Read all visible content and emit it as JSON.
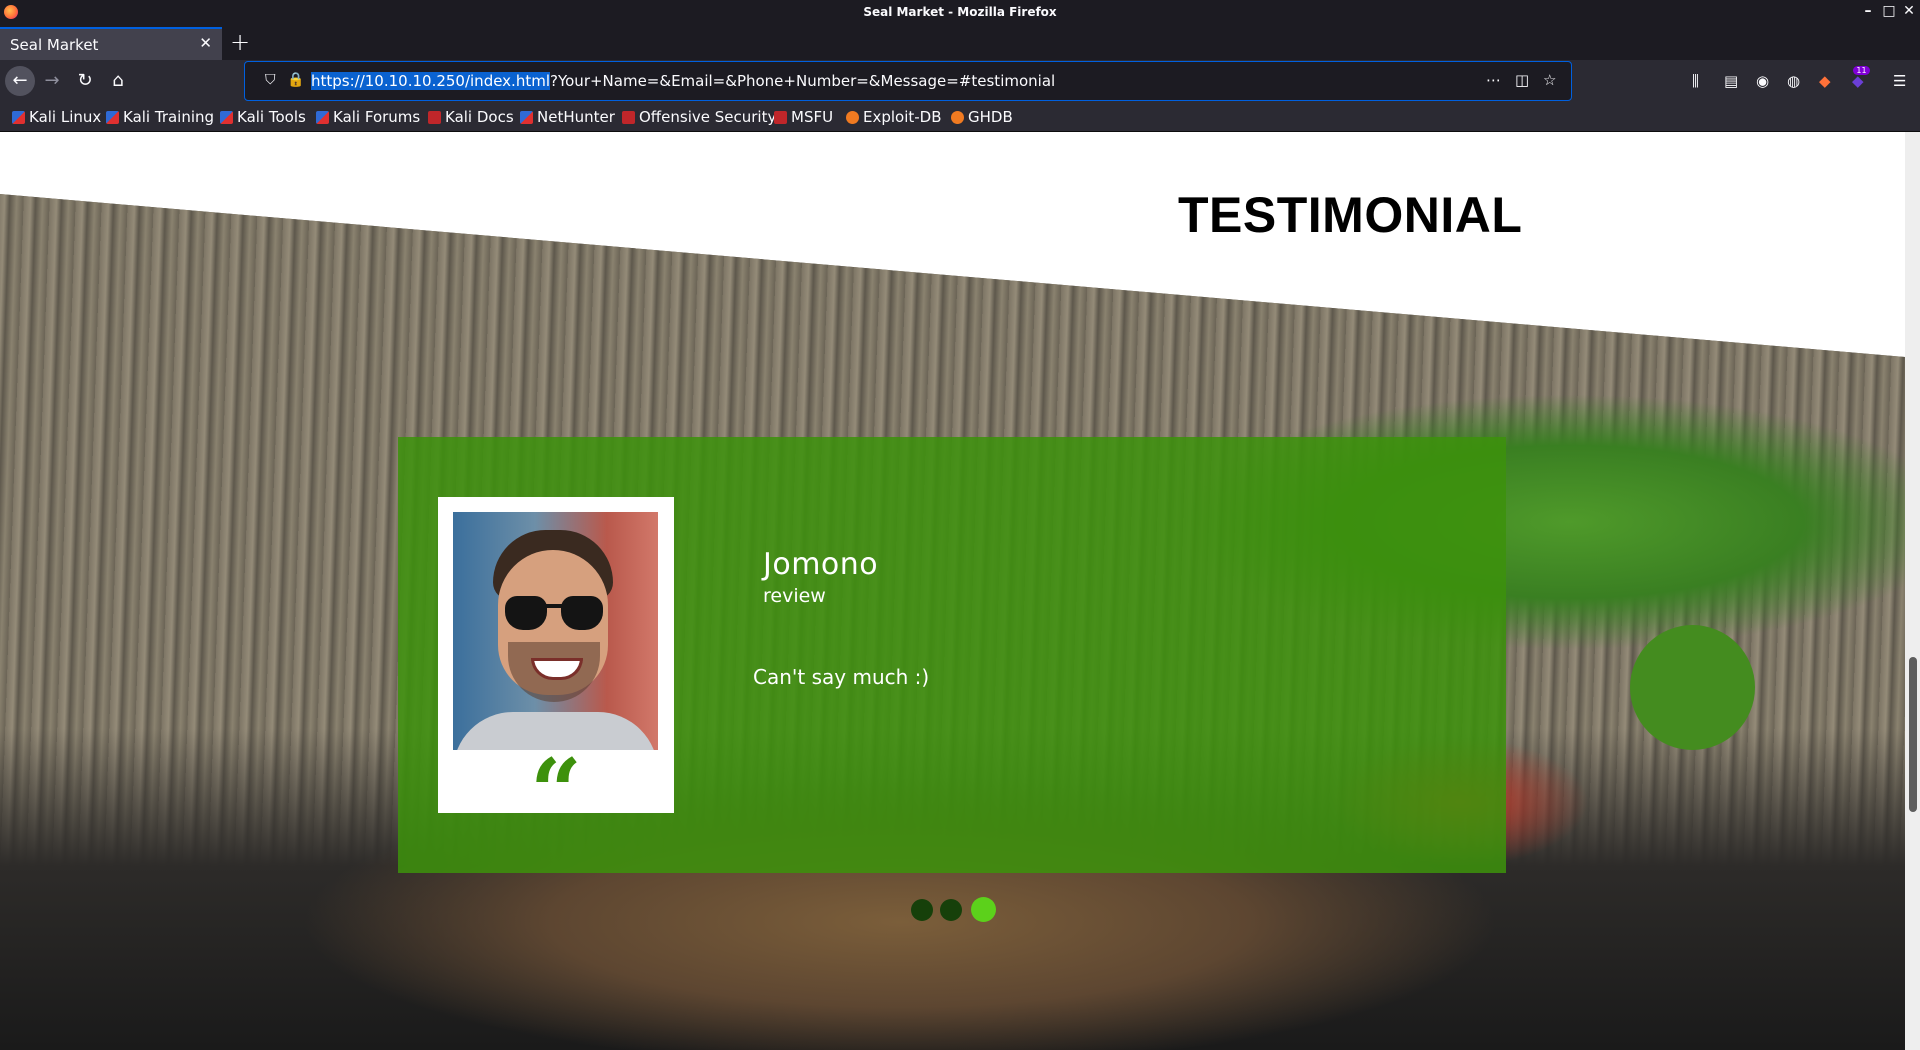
{
  "window": {
    "title": "Seal Market - Mozilla Firefox"
  },
  "tab": {
    "title": "Seal Market",
    "close_glyph": "✕",
    "new_tab_glyph": "+"
  },
  "navbar": {
    "back_glyph": "←",
    "forward_glyph": "→",
    "reload_glyph": "↻",
    "home_glyph": "⌂",
    "url_selected": "https://10.10.10.250/index.html",
    "url_rest": "?Your+Name=&Email=&Phone+Number=&Message=#testimonial",
    "badge_count": "11"
  },
  "bookmarks": [
    {
      "label": "Kali Linux"
    },
    {
      "label": "Kali Training"
    },
    {
      "label": "Kali Tools"
    },
    {
      "label": "Kali Forums"
    },
    {
      "label": "Kali Docs"
    },
    {
      "label": "NetHunter"
    },
    {
      "label": "Offensive Security"
    },
    {
      "label": "MSFU"
    },
    {
      "label": "Exploit-DB"
    },
    {
      "label": "GHDB"
    }
  ],
  "page": {
    "section_title": "TESTIMONIAL",
    "testimonial": {
      "name": "Jomono",
      "role": "review",
      "text": "Can't say much :)",
      "quote_glyph": "“"
    },
    "carousel": {
      "slide_count": 3,
      "active_index": 3
    },
    "colors": {
      "accent_green": "#3d910c",
      "active_dot": "#5cd11b",
      "url_selection": "#0a62d0"
    }
  }
}
